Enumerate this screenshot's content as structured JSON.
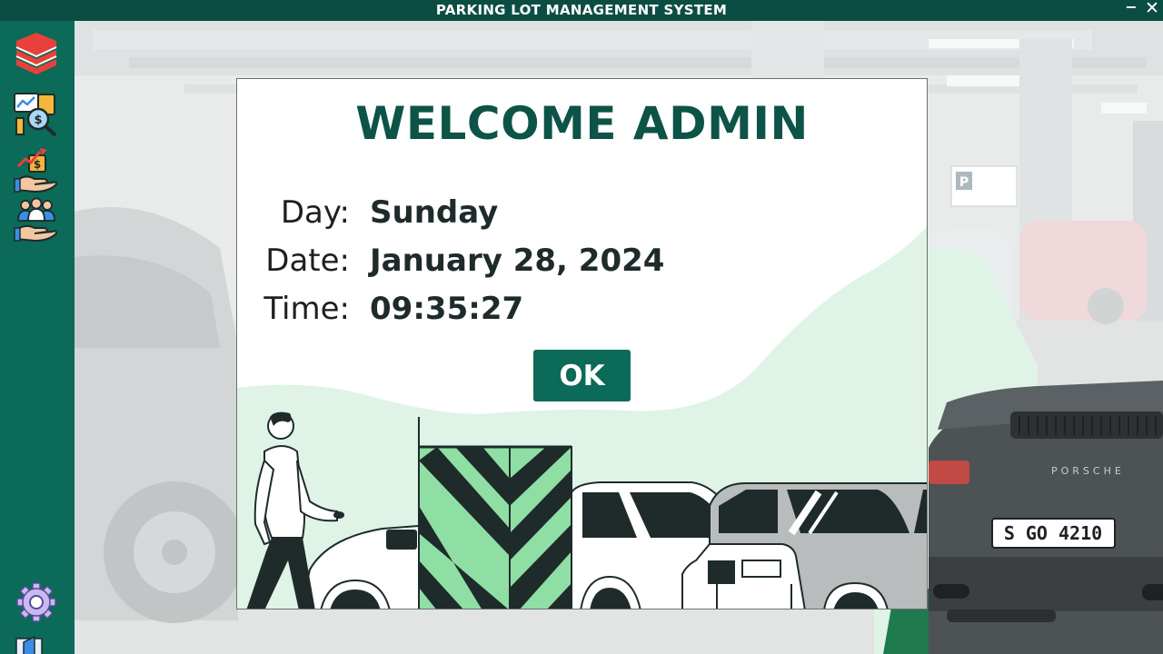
{
  "window": {
    "title": "PARKING LOT MANAGEMENT SYSTEM",
    "minimize_symbol": "−",
    "close_symbol": "✕"
  },
  "sidebar": {
    "items": [
      {
        "name": "layers-icon"
      },
      {
        "name": "analytics-report-icon"
      },
      {
        "name": "revenue-hand-icon"
      },
      {
        "name": "staff-management-icon"
      },
      {
        "name": "settings-gear-icon"
      },
      {
        "name": "logout-door-icon"
      }
    ]
  },
  "dialog": {
    "heading": "WELCOME ADMIN",
    "day_label": "Day:",
    "day_value": "Sunday",
    "date_label": "Date:",
    "date_value": "January 28, 2024",
    "time_label": "Time:",
    "time_value": "09:35:27",
    "ok_label": "OK"
  },
  "background": {
    "license_plate": "S GO 4210",
    "car_brand_text": "PORSCHE"
  },
  "colors": {
    "brand_dark": "#0b4d43",
    "brand": "#0b6a58",
    "mint": "#dff3e6",
    "mint_strong": "#8fdea4",
    "text_dark": "#1e2b2a"
  }
}
